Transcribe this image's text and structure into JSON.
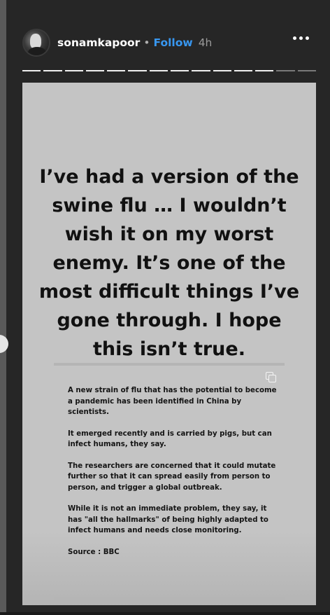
{
  "header": {
    "username": "sonamkapoor",
    "separator": "•",
    "follow_label": "Follow",
    "time_ago": "4h"
  },
  "progress": {
    "segments_total": 14,
    "segments_viewed": 12
  },
  "story": {
    "quote": "I’ve had a version of the swine flu … I wouldn’t wish it on my worst enemy.  It’s one of the most difficult things I’ve gone through. I hope this isn’t true.",
    "article_paragraphs": [
      "A new strain of flu that has the potential to become a pandemic has been identified in China by scientists.",
      "It emerged recently and is carried by pigs, but can infect humans, they say.",
      "The researchers are concerned that it could mutate further so that it can spread easily from person to person, and trigger a global outbreak.",
      "While it is not an immediate problem, they say, it has \"all the hallmarks\" of being highly adapted to infect humans and needs close monitoring.",
      "Source : BBC"
    ]
  },
  "colors": {
    "follow_accent": "#3897f0",
    "background": "#262626",
    "story_background": "#c4c4c4"
  },
  "icons": {
    "more": "more-options-icon",
    "copy": "copy-icon",
    "avatar": "avatar"
  }
}
